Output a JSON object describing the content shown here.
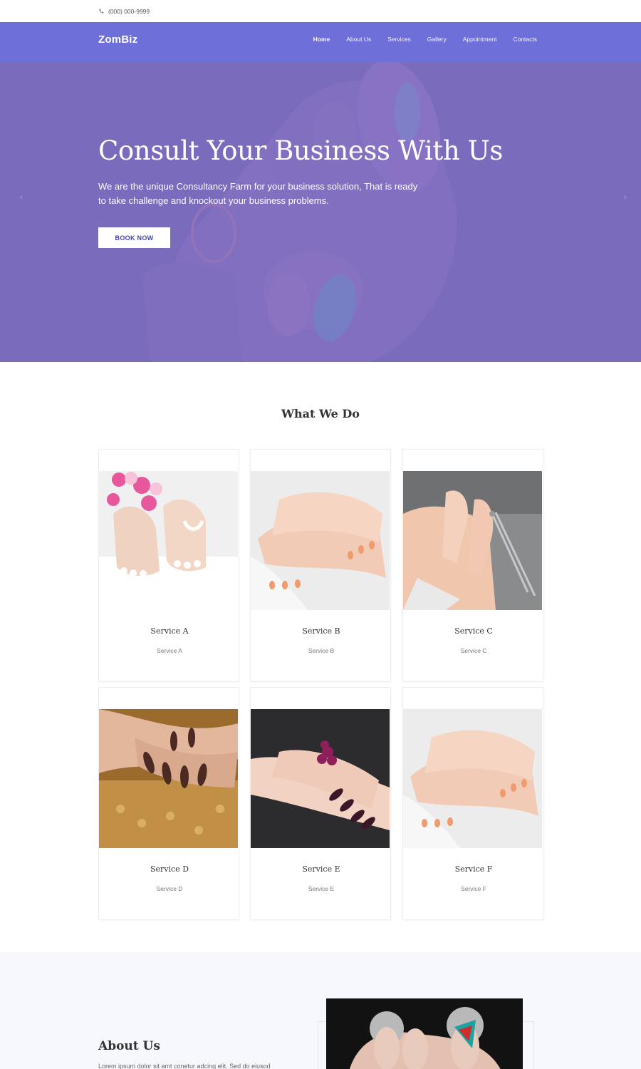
{
  "topbar": {
    "phone": "(000) 000-9999",
    "phone_icon": "phone-icon"
  },
  "nav": {
    "brand": "ZomBiz",
    "items": [
      {
        "label": "Home",
        "active": true
      },
      {
        "label": "About Us",
        "active": false
      },
      {
        "label": "Services",
        "active": false
      },
      {
        "label": "Gallery",
        "active": false
      },
      {
        "label": "Appointment",
        "active": false
      },
      {
        "label": "Contacts",
        "active": false
      }
    ]
  },
  "hero": {
    "title": "Consult Your Business With Us",
    "text": "We are the unique Consultancy Farm for your business solution, That is ready to take challenge and knockout your business problems.",
    "button": "BOOK NOW",
    "prev_icon": "chevron-left-icon",
    "next_icon": "chevron-right-icon"
  },
  "services": {
    "heading": "What We Do",
    "items": [
      {
        "title": "Service A",
        "subtitle": "Service A"
      },
      {
        "title": "Service B",
        "subtitle": "Service B"
      },
      {
        "title": "Service C",
        "subtitle": "Service C"
      },
      {
        "title": "Service D",
        "subtitle": "Service D"
      },
      {
        "title": "Service E",
        "subtitle": "Service E"
      },
      {
        "title": "Service F",
        "subtitle": "Service F"
      }
    ]
  },
  "about": {
    "heading": "About Us",
    "text": "Lorem ipsum dolor sit amt conetur adcing elit. Sed do eiusod"
  },
  "colors": {
    "nav": "#6e6fd8",
    "hero_overlay": "#7c6dbe",
    "button_text": "#4545b0",
    "about_bg": "#f7f8fd"
  }
}
